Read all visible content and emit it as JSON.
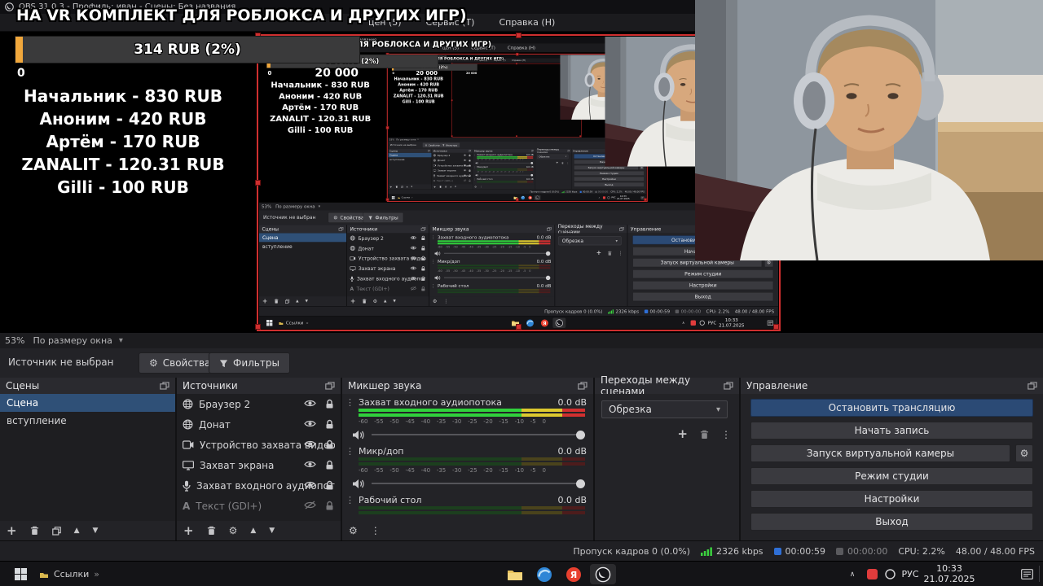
{
  "app": {
    "title": "OBS 31.0.3 - Профиль: иван - Сцены: Без названия",
    "menu": [
      "цен (5)",
      "Сервис (Т)",
      "Справка (Н)"
    ]
  },
  "overlay": {
    "goal_title": "НА VR КОМПЛЕКТ ДЛЯ РОБЛОКСА И ДРУГИХ ИГР)",
    "progress_label": "314 RUB (2%)",
    "progress_percent": 2,
    "range_min": "0",
    "range_max": "20 000",
    "accent_color": "#f0a73c",
    "donors": [
      "Начальник - 830 RUB",
      "Аноним - 420 RUB",
      "Артём - 170 RUB",
      "ZANALIT - 120.31 RUB",
      "Gilli - 100 RUB"
    ]
  },
  "preview": {
    "zoom": "53%",
    "fit": "По размеру окна"
  },
  "source_bar": {
    "status": "Источник не выбран",
    "properties": "Свойства",
    "filters": "Фильтры"
  },
  "docks": {
    "scenes": {
      "title": "Сцены",
      "items": [
        {
          "label": "Сцена",
          "selected": true
        },
        {
          "label": "вступление",
          "selected": false
        }
      ]
    },
    "sources": {
      "title": "Источники",
      "items": [
        {
          "label": "Браузер 2",
          "icon": "globe-icon",
          "visible": true,
          "locked": true
        },
        {
          "label": "Донат",
          "icon": "globe-icon",
          "visible": true,
          "locked": true
        },
        {
          "label": "Устройство захвата видео",
          "icon": "camera-icon",
          "visible": true,
          "locked": true
        },
        {
          "label": "Захват экрана",
          "icon": "display-icon",
          "visible": true,
          "locked": true
        },
        {
          "label": "Захват входного аудиопот",
          "icon": "mic-icon",
          "visible": true,
          "locked": true
        },
        {
          "label": "Текст (GDI+)",
          "icon": "text-icon",
          "visible": false,
          "locked": true
        }
      ]
    },
    "mixer": {
      "title": "Микшер звука",
      "scale_text": "-60 -55 -50 -45 -40 -35 -30 -25 -20 -15 -10 -5 0",
      "channels": [
        {
          "label": "Захват входного аудиопотока",
          "db": "0.0 dB",
          "active": true
        },
        {
          "label": "Микр/доп",
          "db": "0.0 dB",
          "active": false
        },
        {
          "label": "Рабочий стол",
          "db": "0.0 dB",
          "active": false
        }
      ]
    },
    "transitions": {
      "title": "Переходы между сценами",
      "selected": "Обрезка"
    },
    "controls": {
      "title": "Управление",
      "buttons": [
        "Остановить трансляцию",
        "Начать запись",
        "Запуск виртуальной камеры",
        "Режим студии",
        "Настройки",
        "Выход"
      ]
    }
  },
  "status_bar": {
    "dropped_frames": "Пропуск кадров 0 (0.0%)",
    "bitrate": "2326 kbps",
    "stream_time": "00:00:59",
    "rec_time": "00:00:00",
    "cpu": "CPU: 2.2%",
    "fps": "48.00 / 48.00 FPS"
  },
  "taskbar": {
    "links_label": "Ссылки",
    "lang": "РУС",
    "time": "10:33",
    "date": "21.07.2025"
  },
  "icons": {
    "plus": "+",
    "gear": "⚙",
    "dots": "⋮",
    "caret_down": "▾",
    "up": "▲",
    "down": "▼",
    "tray_caret": "∧",
    "overflow": "»",
    "text_source": "A"
  },
  "colors": {
    "selection_red": "#cf2f2f",
    "selected_row_blue": "#2f5077",
    "stream_button_blue": "#2b4a75",
    "meter_green": "#30d13c",
    "meter_yellow": "#ddc92f",
    "meter_red": "#d13030",
    "bitrate_green": "#3bd23f",
    "stream_timer_blue": "#2f6fd6"
  }
}
